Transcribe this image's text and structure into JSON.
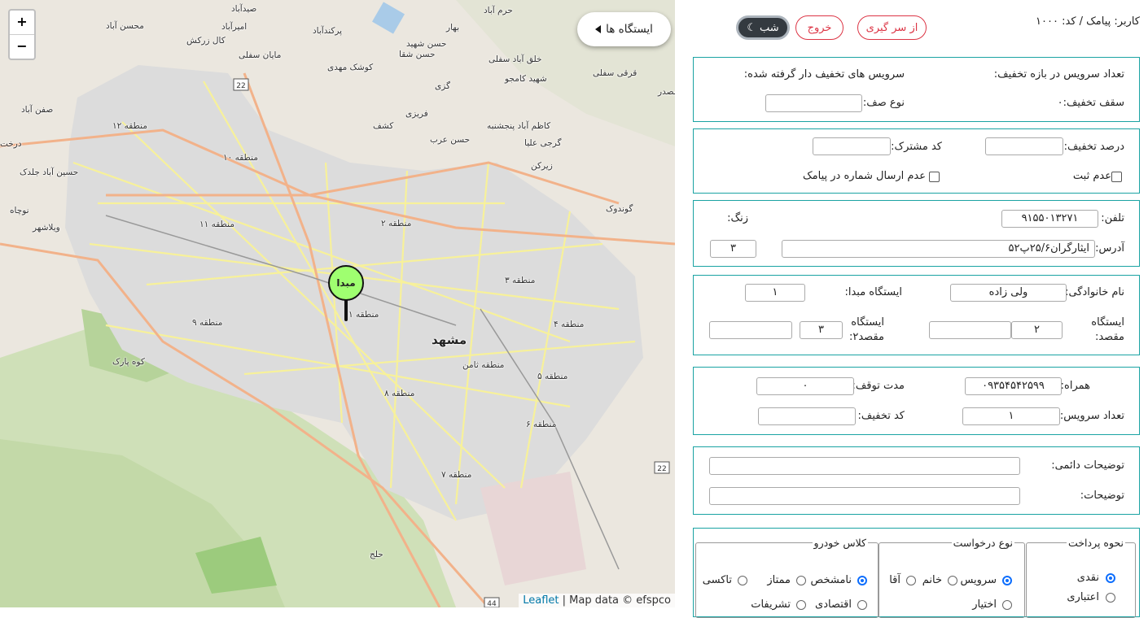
{
  "map": {
    "zoom_in": "+",
    "zoom_out": "−",
    "stations_button": "ایستگاه ها",
    "marker_label": "مبدا",
    "attribution_link": "Leaflet",
    "attribution_text": " | Map data © efspco",
    "road_shields": [
      "22",
      "22",
      "44"
    ],
    "labels": {
      "city": "مشهد",
      "z1": "منطقه ۱",
      "z2": "منطقه ۲",
      "z3": "منطقه ۳",
      "z4": "منطقه ۴",
      "z5": "منطقه ۵",
      "z6": "منطقه ۶",
      "z7": "منطقه ۷",
      "z8": "منطقه ۸",
      "z9": "منطقه ۹",
      "z10": "منطقه ۱۰",
      "z11": "منطقه ۱۱",
      "z12": "منطقه ۱۲",
      "tamin": "منطقه ثامن",
      "p1": "صیدآباد",
      "p2": "امیرآباد",
      "p3": "پرکندآباد",
      "p4": "کال زرکش",
      "p5": "مایان سفلی",
      "p6": "کوشک مهدی",
      "p7": "حسن شهید",
      "p8": "حسن شقا",
      "p9": "خلق آباد سفلی",
      "p10": "شهید کامجو",
      "p11": "بهار",
      "p12": "حرم آباد",
      "p13": "گزی",
      "p14": "فریزی",
      "p15": "کشف",
      "p16": "کاظم آباد پنجشنبه",
      "p17": "حسن عرب",
      "p18": "گرجی علیا",
      "p19": "زیرکن",
      "p20": "قرقی سفلی",
      "p21": "گوندوک",
      "p22": "صفن آباد",
      "p23": "حسین آباد جلدک",
      "p24": "درخت",
      "p25": "نوچاه",
      "p26": "ویلاشهر",
      "p27": "کوه پارک",
      "p28": "حلج",
      "p29": "محسن آباد",
      "p30": "مصدر"
    }
  },
  "panel": {
    "user_label": "کاربر: پیامک / کد: ۱۰۰۰",
    "restart_button": "از سر گیری",
    "exit_button": "خروج",
    "night_button": "شب",
    "discount": {
      "count_label": "تعداد سرویس در بازه تخفیف:",
      "discounted_label": "سرویس های تخفیف دار گرفته شده:",
      "ceiling_label": "سقف تخفیف:۰",
      "queue_type_label": "نوع صف:",
      "queue_type_value": ""
    },
    "percent": {
      "percent_label": "درصد تخفیف:",
      "percent_value": "",
      "customer_code_label": "کد مشترک:",
      "customer_code_value": "",
      "no_register_label": "عدم ثبت",
      "no_sms_label": "عدم ارسال شماره در پیامک"
    },
    "contact": {
      "phone_label": "تلفن:",
      "phone_value": "۹۱۵۵۰۱۳۲۷۱",
      "ring_label": "زنگ:",
      "address_label": "آدرس:",
      "address_value": "ایثارگران۲۵/۶پ۵۲",
      "address_num": "۳"
    },
    "trip": {
      "family_label": "نام خانوادگی:",
      "family_value": "ولی زاده",
      "origin_label": "ایستگاه مبدا:",
      "origin_value": "۱",
      "dest_label": "ایستگاه مقصد:",
      "dest_value": "۲",
      "dest_extra": "",
      "dest2_label": "ایستگاه مقصد۲:",
      "dest2_value": "۳",
      "dest2_extra": ""
    },
    "service": {
      "mobile_label": "همراه:",
      "mobile_value": "۰۹۳۵۴۵۴۲۵۹۹",
      "stop_label": "مدت توقف:",
      "stop_value": "۰",
      "count_label": "تعداد سرویس:",
      "count_value": "۱",
      "discount_code_label": "کد تخفیف:",
      "discount_code_value": ""
    },
    "notes": {
      "permanent_label": "توضیحات دائمی:",
      "permanent_value": "",
      "notes_label": "توضیحات:",
      "notes_value": ""
    },
    "payment": {
      "legend": "نحوه پرداخت",
      "cash": "نقدی",
      "credit": "اعتباری",
      "selected": "نقدی"
    },
    "request": {
      "legend": "نوع درخواست",
      "service": "سرویس",
      "lady": "خانم",
      "sir": "آقا",
      "optional": "اختیار",
      "selected": "سرویس"
    },
    "vehicle": {
      "legend": "کلاس خودرو",
      "unknown": "نامشخص",
      "premium": "ممتاز",
      "taxi": "تاکسی",
      "economy": "اقتصادی",
      "vip": "تشریفات",
      "selected": "نامشخص"
    }
  }
}
